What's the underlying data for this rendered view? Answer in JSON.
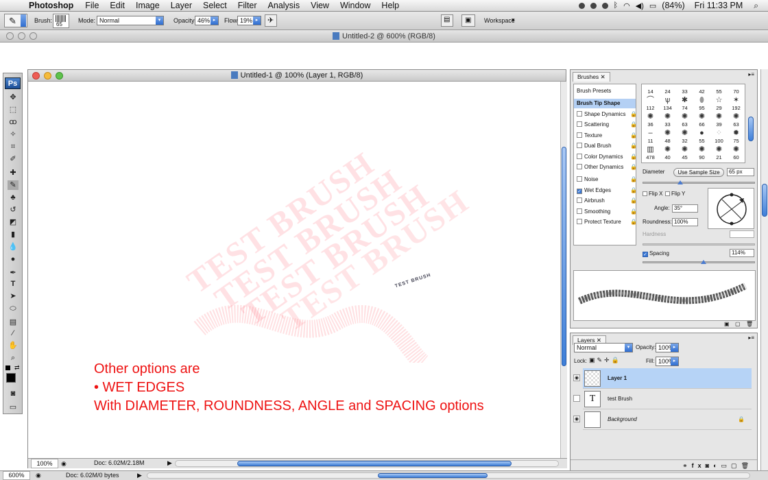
{
  "menubar": {
    "app": "Photoshop",
    "items": [
      "File",
      "Edit",
      "Image",
      "Layer",
      "Select",
      "Filter",
      "Analysis",
      "View",
      "Window",
      "Help"
    ],
    "battery": "(84%)",
    "clock": "Fri 11:33 PM"
  },
  "options": {
    "brush_label": "Brush:",
    "brush_size": "65",
    "mode_label": "Mode:",
    "mode_value": "Normal",
    "opacity_label": "Opacity:",
    "opacity_value": "46%",
    "flow_label": "Flow:",
    "flow_value": "19%",
    "workspace_label": "Workspace"
  },
  "doc2": {
    "title": "Untitled-2 @ 600% (RGB/8)",
    "zoom": "600%",
    "doc_info": "Doc: 6.02M/0 bytes"
  },
  "doc1": {
    "title": "Untitled-1 @ 100% (Layer 1, RGB/8)",
    "zoom": "100%",
    "doc_info": "Doc: 6.02M/2.18M",
    "stamp_text": "TEST BRUSH",
    "small_stamp": "TEST BRUSH",
    "annotation_lines": [
      "Other options are",
      "• WET EDGES",
      "With DIAMETER, ROUNDNESS, ANGLE and SPACING options"
    ]
  },
  "toolbox": {
    "logo": "Ps"
  },
  "brushes": {
    "tab": "Brushes",
    "presets": "Brush Presets",
    "tip_shape": "Brush Tip Shape",
    "options": [
      {
        "label": "Shape Dynamics",
        "checked": false
      },
      {
        "label": "Scattering",
        "checked": false
      },
      {
        "label": "Texture",
        "checked": false
      },
      {
        "label": "Dual Brush",
        "checked": false
      },
      {
        "label": "Color Dynamics",
        "checked": false
      },
      {
        "label": "Other Dynamics",
        "checked": false
      },
      {
        "label": "Noise",
        "checked": false
      },
      {
        "label": "Wet Edges",
        "checked": true
      },
      {
        "label": "Airbrush",
        "checked": false
      },
      {
        "label": "Smoothing",
        "checked": false
      },
      {
        "label": "Protect Texture",
        "checked": false
      }
    ],
    "grid_top": [
      "14",
      "24",
      "33",
      "42",
      "55",
      "70"
    ],
    "grid_rows": [
      [
        "112",
        "134",
        "74",
        "95",
        "29",
        "192"
      ],
      [
        "36",
        "33",
        "63",
        "66",
        "39",
        "63"
      ],
      [
        "11",
        "48",
        "32",
        "55",
        "100",
        "75"
      ],
      [
        "478",
        "40",
        "45",
        "90",
        "21",
        "60"
      ]
    ],
    "diameter_label": "Diameter",
    "use_sample": "Use Sample Size",
    "diameter_value": "65 px",
    "flip_x": "Flip X",
    "flip_y": "Flip Y",
    "angle_label": "Angle:",
    "angle_value": "35°",
    "roundness_label": "Roundness:",
    "roundness_value": "100%",
    "hardness_label": "Hardness",
    "spacing_label": "Spacing",
    "spacing_value": "114%"
  },
  "layers": {
    "tab": "Layers",
    "blend": "Normal",
    "opacity_label": "Opacity:",
    "opacity_value": "100%",
    "lock_label": "Lock:",
    "fill_label": "Fill:",
    "fill_value": "100%",
    "items": [
      {
        "name": "Layer 1",
        "selected": true
      },
      {
        "name": "test Brush",
        "selected": false
      },
      {
        "name": "Background",
        "selected": false
      }
    ]
  }
}
